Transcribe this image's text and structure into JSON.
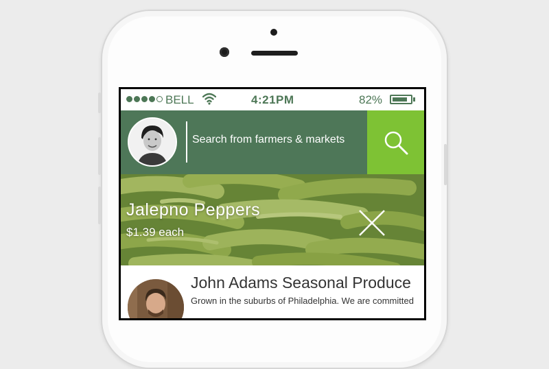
{
  "statusbar": {
    "signal_filled": 4,
    "signal_total": 5,
    "carrier": "BELL",
    "time": "4:21PM",
    "battery_percent": "82%",
    "battery_level": 0.82
  },
  "search": {
    "placeholder": "Search from farmers & markets"
  },
  "product": {
    "name": "Jalepno Peppers",
    "price": "$1.39 each"
  },
  "vendor": {
    "name": "John Adams Seasonal Produce",
    "description": "Grown in the suburbs of Philadelphia. We are committed"
  },
  "colors": {
    "brand_green": "#4e7758",
    "accent_green": "#7ec234"
  },
  "icons": {
    "search": "search-icon",
    "close": "close-icon",
    "wifi": "wifi-icon",
    "battery": "battery-icon"
  }
}
